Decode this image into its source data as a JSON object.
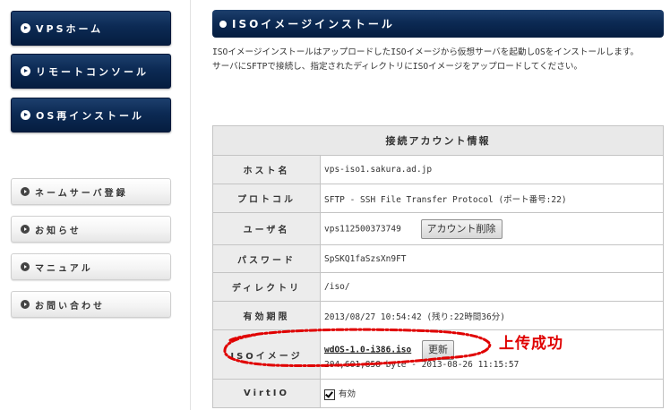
{
  "sidebar": {
    "primary": [
      {
        "label": "VPSホーム"
      },
      {
        "label": "リモートコンソール"
      },
      {
        "label": "OS再インストール"
      }
    ],
    "secondary": [
      {
        "label": "ネームサーバ登録"
      },
      {
        "label": "お知らせ"
      },
      {
        "label": "マニュアル"
      },
      {
        "label": "お問い合わせ"
      }
    ]
  },
  "main": {
    "title": "ISOイメージインストール",
    "description": [
      "ISOイメージインストールはアップロードしたISOイメージから仮想サーバを起動しOSをインストールします。",
      "サーバにSFTPで接続し、指定されたディレクトリにISOイメージをアップロードしてください。"
    ],
    "table": {
      "caption": "接続アカウント情報",
      "host_label": "ホスト名",
      "host_value": "vps-iso1.sakura.ad.jp",
      "protocol_label": "プロトコル",
      "protocol_value": "SFTP - SSH File Transfer Protocol (ポート番号:22)",
      "user_label": "ユーザ名",
      "user_value": "vps112500373749",
      "delete_button": "アカウント削除",
      "password_label": "パスワード",
      "password_value": "SpSKQ1faSzsXn9FT",
      "dir_label": "ディレクトリ",
      "dir_value": "/iso/",
      "expiry_label": "有効期限",
      "expiry_value": "2013/08/27 10:54:42 (残り:22時間36分)",
      "iso_label": "ISOイメージ",
      "iso_file": "wdOS-1.0-i386.iso",
      "refresh_button": "更新",
      "iso_info": "204,601,858 byte - 2013-08-26 11:15:57",
      "virtio_label": "VirtIO",
      "virtio_value": "有効"
    }
  },
  "annotation": {
    "text": "上传成功",
    "color": "#e00000"
  }
}
